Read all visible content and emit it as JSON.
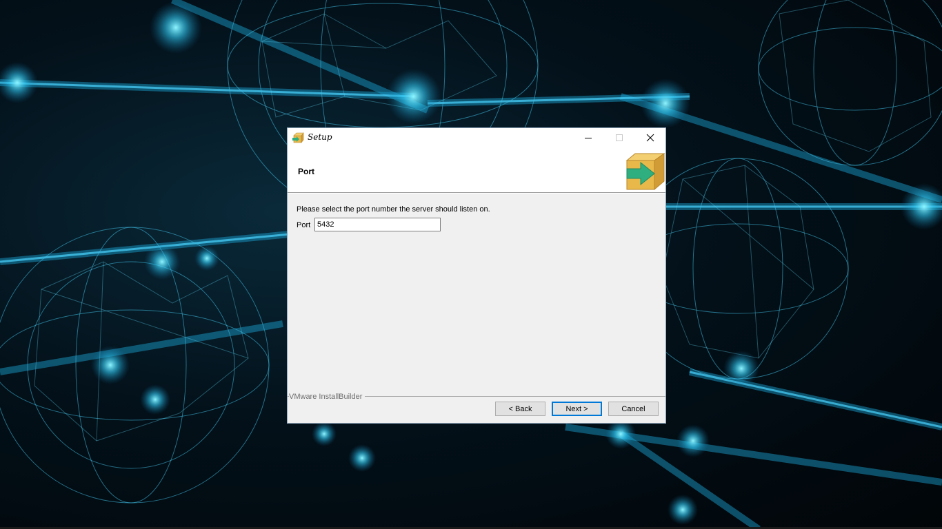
{
  "window": {
    "title": "Setup"
  },
  "header": {
    "page_title": "Port"
  },
  "content": {
    "instruction": "Please select the port number the server should listen on.",
    "port_label": "Port",
    "port_value": "5432"
  },
  "footer": {
    "brand": "VMware InstallBuilder",
    "back_label": "< Back",
    "next_label": "Next >",
    "cancel_label": "Cancel"
  },
  "icons": {
    "app": "installer-box-icon",
    "minimize": "minimize-icon",
    "maximize": "maximize-icon",
    "close": "close-icon",
    "logo": "installer-box-logo"
  },
  "colors": {
    "accent": "#0078d7",
    "box": "#e8b84a",
    "arrow": "#2fae7f"
  }
}
